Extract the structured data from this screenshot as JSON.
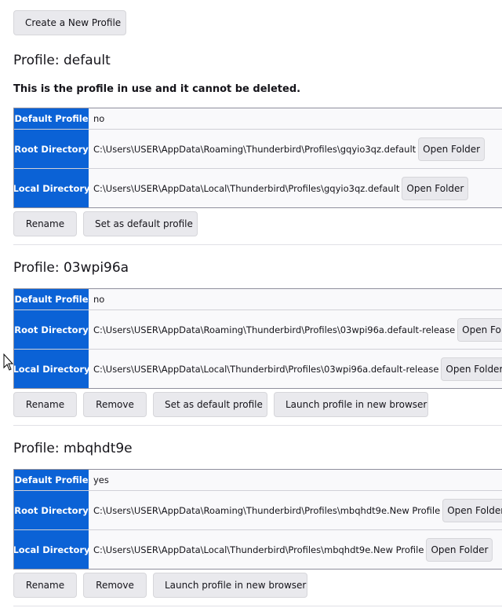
{
  "create_button": "Create a New Profile",
  "open_folder_label": "Open Folder",
  "default_note": "This is the profile in use and it cannot be deleted.",
  "labels": {
    "default_profile": "Default Profile",
    "root_directory": "Root Directory",
    "local_directory": "Local Directory"
  },
  "actions": {
    "rename": "Rename",
    "remove": "Remove",
    "set_default": "Set as default profile",
    "launch": "Launch profile in new browser"
  },
  "profiles": [
    {
      "title": "Profile: default",
      "is_default": "no",
      "root_dir": "C:\\Users\\USER\\AppData\\Roaming\\Thunderbird\\Profiles\\gqyio3qz.default",
      "local_dir": "C:\\Users\\USER\\AppData\\Local\\Thunderbird\\Profiles\\gqyio3qz.default"
    },
    {
      "title": "Profile: 03wpi96a",
      "is_default": "no",
      "root_dir": "C:\\Users\\USER\\AppData\\Roaming\\Thunderbird\\Profiles\\03wpi96a.default-release",
      "local_dir": "C:\\Users\\USER\\AppData\\Local\\Thunderbird\\Profiles\\03wpi96a.default-release"
    },
    {
      "title": "Profile: mbqhdt9e",
      "is_default": "yes",
      "root_dir": "C:\\Users\\USER\\AppData\\Roaming\\Thunderbird\\Profiles\\mbqhdt9e.New Profile",
      "local_dir": "C:\\Users\\USER\\AppData\\Local\\Thunderbird\\Profiles\\mbqhdt9e.New Profile"
    }
  ]
}
